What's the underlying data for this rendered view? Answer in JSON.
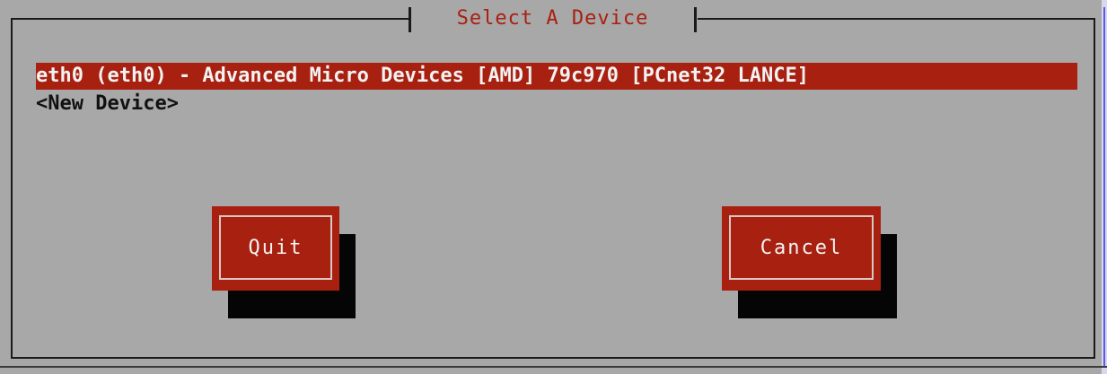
{
  "dialog": {
    "title": "Select A Device"
  },
  "devices": [
    {
      "label": "eth0 (eth0) - Advanced Micro Devices [AMD] 79c970 [PCnet32 LANCE]",
      "selected": true
    },
    {
      "label": "<New Device>",
      "selected": false
    }
  ],
  "buttons": {
    "quit_label": "Quit",
    "cancel_label": "Cancel"
  },
  "colors": {
    "background": "#a8a8a8",
    "accent": "#a82010",
    "title_text": "#a82010",
    "shadow": "#050505",
    "frame": "#1a1a1a"
  }
}
